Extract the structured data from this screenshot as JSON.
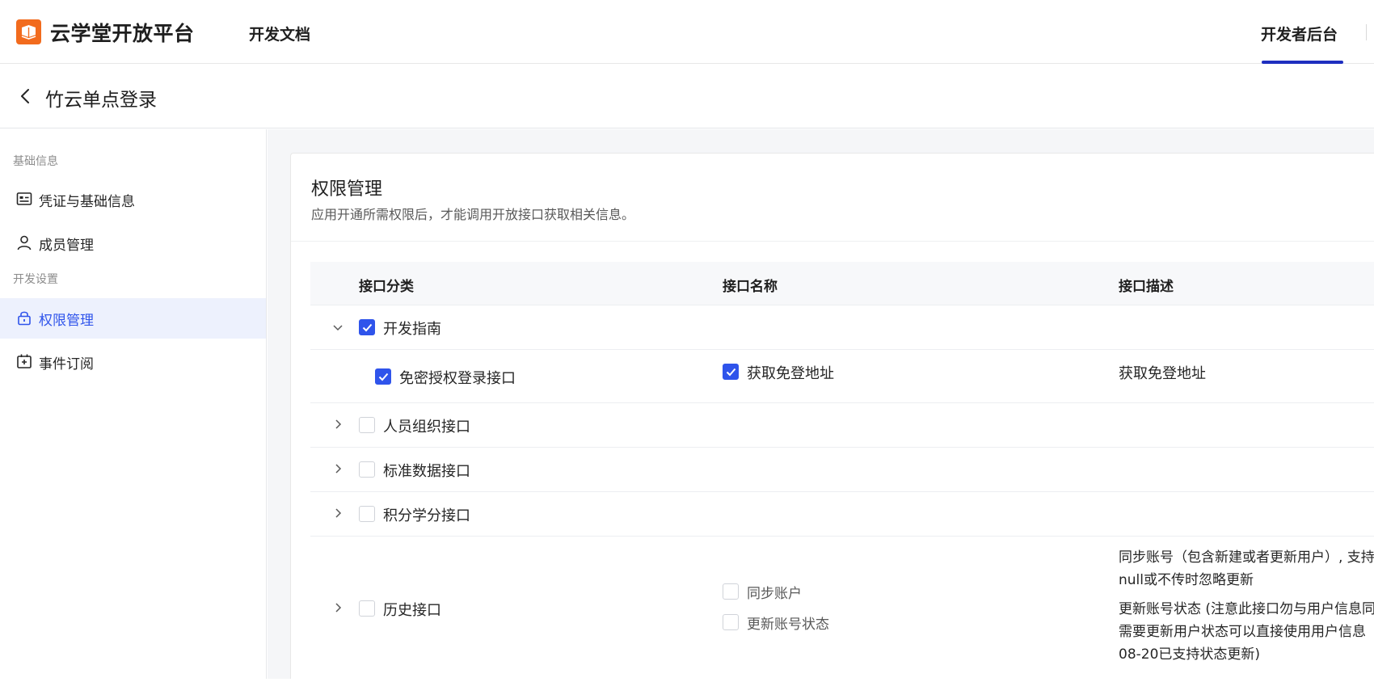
{
  "header": {
    "brand": "云学堂开放平台",
    "nav_docs": "开发文档",
    "nav_console": "开发者后台"
  },
  "subheader": {
    "title": "竹云单点登录"
  },
  "sidebar": {
    "group_basic": "基础信息",
    "group_dev": "开发设置",
    "items": [
      {
        "label": "凭证与基础信息",
        "icon": "id-card-icon"
      },
      {
        "label": "成员管理",
        "icon": "user-icon"
      },
      {
        "label": "权限管理",
        "icon": "lock-icon",
        "active": true
      },
      {
        "label": "事件订阅",
        "icon": "event-icon"
      }
    ]
  },
  "permissions": {
    "title": "权限管理",
    "desc": "应用开通所需权限后，才能调用开放接口获取相关信息。",
    "columns": [
      "接口分类",
      "接口名称",
      "接口描述"
    ],
    "rows": [
      {
        "category": "开发指南",
        "checked": true,
        "expanded": true
      },
      {
        "sub_category": "免密授权登录接口",
        "checked": true,
        "api_name": "获取免登地址",
        "api_checked": true,
        "api_desc": "获取免登地址"
      },
      {
        "category": "人员组织接口",
        "checked": false,
        "expanded": false
      },
      {
        "category": "标准数据接口",
        "checked": false,
        "expanded": false
      },
      {
        "category": "积分学分接口",
        "checked": false,
        "expanded": false
      },
      {
        "category": "历史接口",
        "checked": false,
        "expanded": false,
        "apis": [
          {
            "name": "同步账户",
            "checked": false
          },
          {
            "name": "更新账号状态",
            "checked": false
          }
        ],
        "desc_lines": [
          "同步账号（包含新建或者更新用户）, 支持",
          "null或不传时忽略更新",
          "更新账号状态 (注意此接口勿与用户信息同",
          "需要更新用户状态可以直接使用用户信息",
          "08-20已支持状态更新)"
        ]
      }
    ]
  },
  "colors": {
    "accent": "#2f54eb",
    "brand_orange": "#f26b1d",
    "active_bg": "#edf1fd"
  }
}
